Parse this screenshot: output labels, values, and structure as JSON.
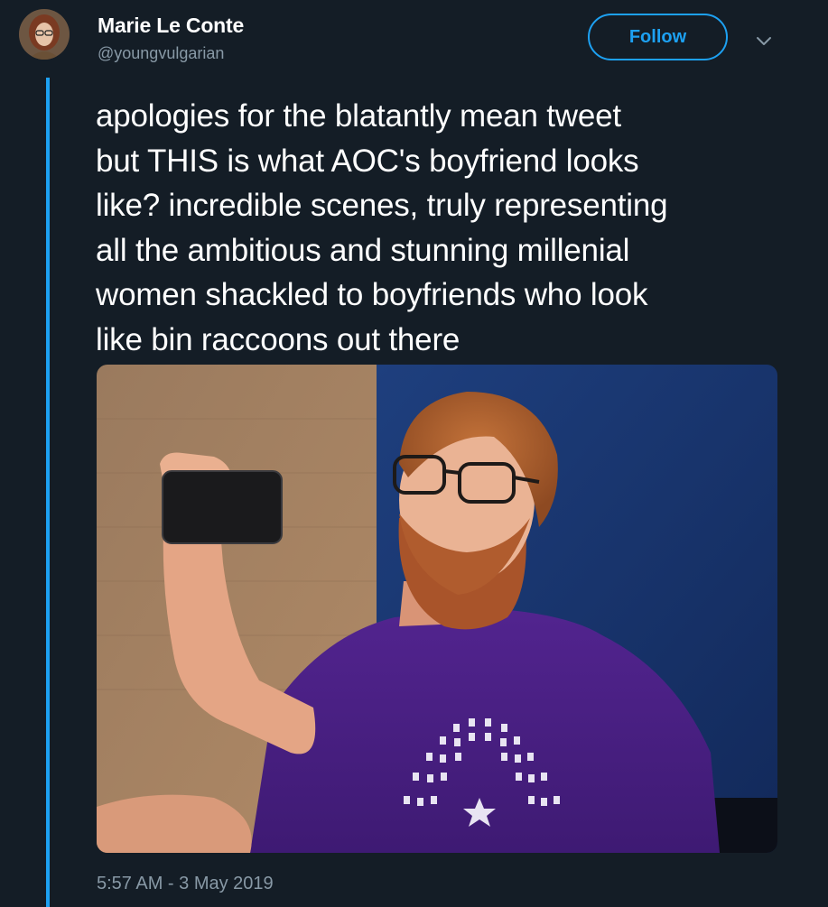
{
  "author": {
    "display_name": "Marie Le Conte",
    "handle": "@youngvulgarian"
  },
  "follow_label": "Follow",
  "tweet": {
    "lines": [
      "apologies for the blatantly mean tweet",
      "but THIS is what AOC's boyfriend looks",
      "like? incredible scenes, truly representing",
      "all the ambitious and stunning millenial",
      "women shackled to boyfriends who look",
      "like bin raccoons out there"
    ]
  },
  "timestamp": "5:57 AM - 3 May 2019",
  "colors": {
    "background": "#141d26",
    "accent": "#1da1f2",
    "secondary_text": "#8899a6",
    "shirt": "#4a1f86"
  },
  "icons": {
    "chevron": "chevron-down-icon"
  }
}
